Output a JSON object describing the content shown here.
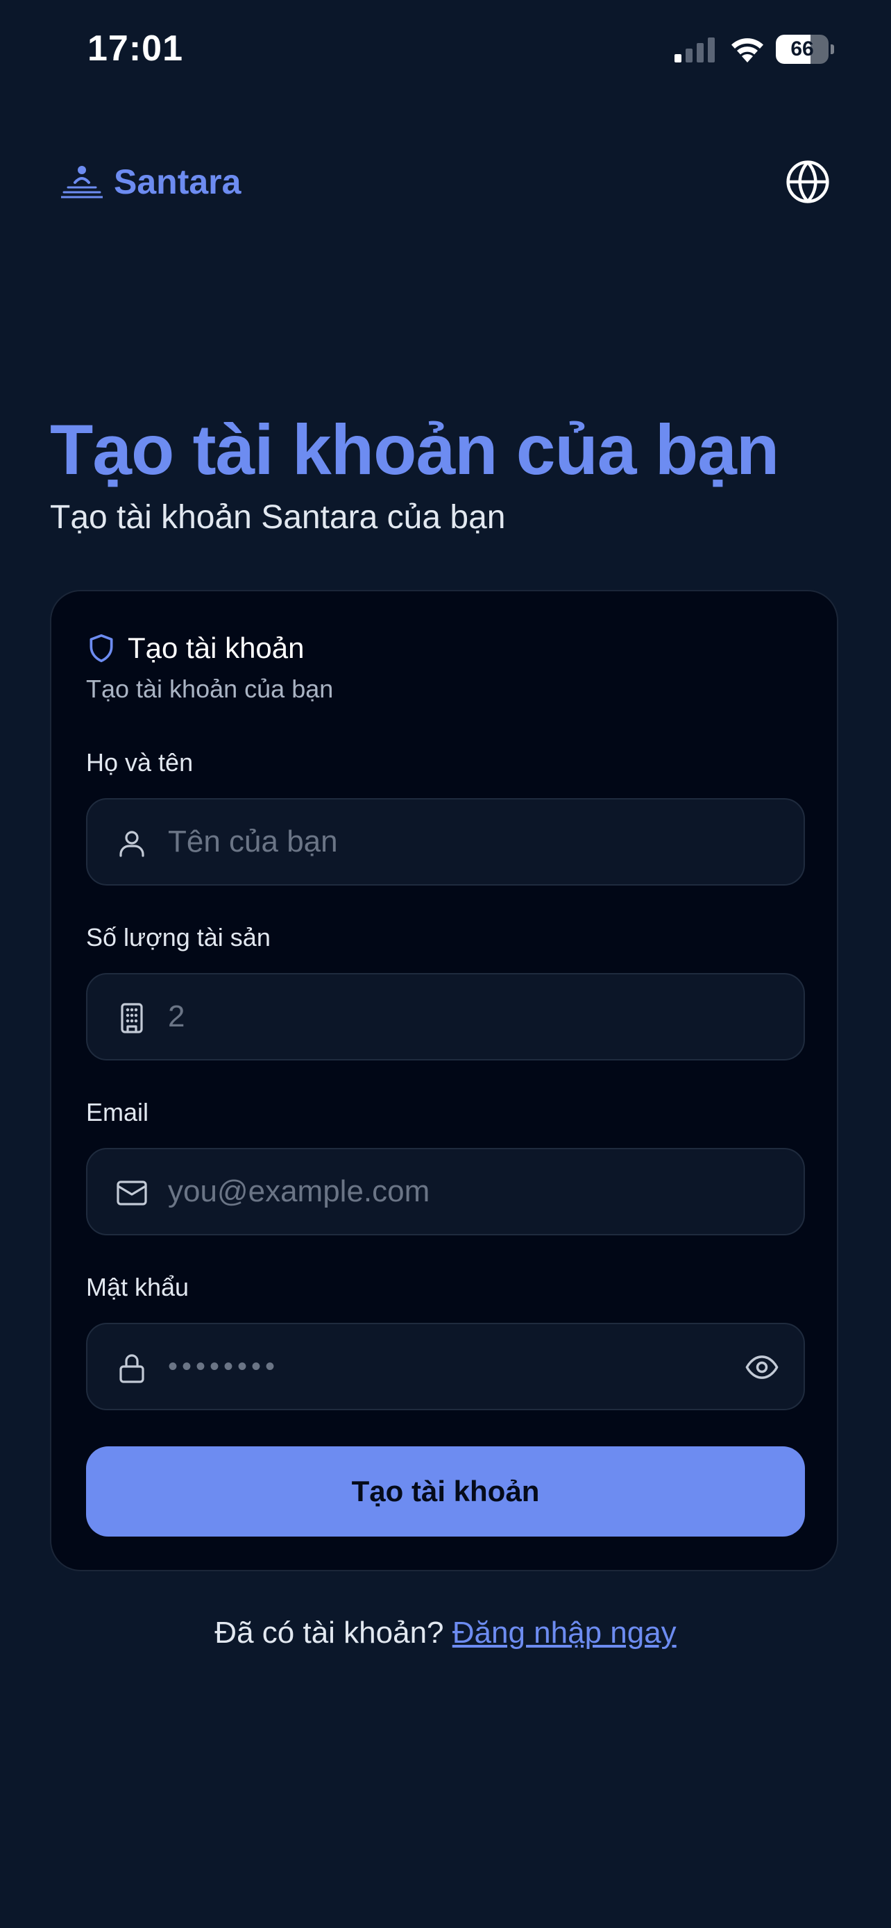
{
  "status_bar": {
    "time": "17:01",
    "battery_level": "66",
    "battery_fraction": 0.66
  },
  "header": {
    "logo_text": "Santara",
    "logo_icon": "person-stack-icon",
    "language_icon": "globe-icon"
  },
  "page": {
    "title": "Tạo tài khoản của bạn",
    "subtitle": "Tạo tài khoản Santara của bạn"
  },
  "card": {
    "title": "Tạo tài khoản",
    "subtitle": "Tạo tài khoản của bạn",
    "icon": "shield-icon"
  },
  "form": {
    "fields": [
      {
        "label": "Họ và tên",
        "placeholder": "Tên của bạn",
        "value": "",
        "icon": "user-icon"
      },
      {
        "label": "Số lượng tài sản",
        "placeholder": "2",
        "value": "",
        "icon": "building-icon"
      },
      {
        "label": "Email",
        "placeholder": "you@example.com",
        "value": "",
        "icon": "mail-icon"
      },
      {
        "label": "Mật khẩu",
        "placeholder": "••••••••",
        "value": "",
        "icon": "lock-icon",
        "toggle_icon": "eye-icon"
      }
    ],
    "submit_label": "Tạo tài khoản"
  },
  "footer": {
    "prompt": "Đã có tài khoản?",
    "link_label": "Đăng nhập ngay"
  },
  "colors": {
    "background": "#0b172a",
    "card": "#010716",
    "accent": "#6d8cf1",
    "field": "#0c1628"
  }
}
